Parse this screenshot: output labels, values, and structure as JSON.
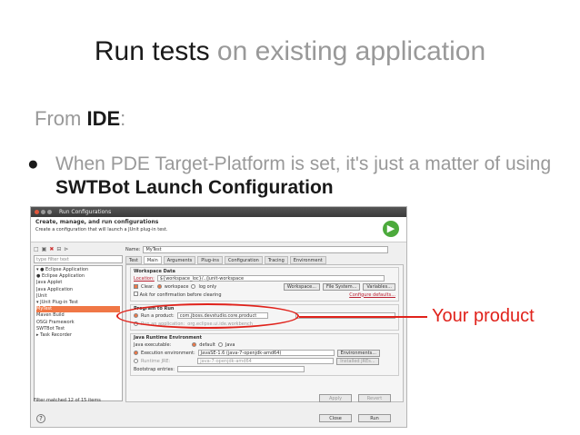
{
  "slide": {
    "title_dark": "Run tests",
    "title_light": " on existing application",
    "from_label": "From ",
    "from_ide": "IDE",
    "from_colon": ":",
    "bullet_dot": "●",
    "bullet_text_1": "When PDE Target-Platform is set, it's just a matter of using ",
    "bullet_bold": "SWTBot Launch Configuration",
    "callout": "Your product"
  },
  "dialog": {
    "window_title": "Run Configurations",
    "header_title": "Create, manage, and run configurations",
    "header_subtitle": "Create a configuration that will launch a JUnit plug-in test.",
    "run_icon": "play-icon",
    "filter_placeholder": "type filter text",
    "tree": [
      "▾ ● Eclipse Application",
      "   ● Eclipse Application",
      "  Java Applet",
      "  Java Application",
      "  JUnit",
      "▾ JUnit Plug-in Test",
      "   MyTest",
      "  Maven Build",
      "  OSGi Framework",
      "  SWTBot Test",
      "▸ Task Recorder"
    ],
    "filtered_status": "Filter matched 12 of 15 items",
    "name_label": "Name:",
    "name_value": "MyTest",
    "tabs": [
      "Test",
      "Main",
      "Arguments",
      "Plug-ins",
      "Configuration",
      "Tracing",
      "Environment"
    ],
    "workspace": {
      "group_label": "Workspace Data",
      "location_label": "Location:",
      "location_value": "${workspace_loc}/../junit-workspace",
      "workspace_btn": "Workspace...",
      "filesystem_btn": "File System...",
      "variables_btn": "Variables...",
      "clear_label": "Clear:",
      "clear_workspace": "workspace",
      "clear_log": "log only",
      "ask_label": "Ask for confirmation before clearing",
      "configure_link": "Configure defaults..."
    },
    "program": {
      "group_label": "Program to Run",
      "run_product_label": "Run a product:",
      "run_product_value": "com.jboss.devstudio.core.product",
      "run_application_label": "Run an application:",
      "run_application_value": "org.eclipse.ui.ide.workbench"
    },
    "java": {
      "group_label": "Java Runtime Environment",
      "executable_label": "Java executable:",
      "exec_default": "default",
      "exec_java": "Java",
      "env_label": "Execution environment:",
      "env_value": "JavaSE-1.6 (java-7-openjdk-amd64)",
      "environments_btn": "Environments...",
      "jre_label": "Runtime JRE:",
      "jre_value": "java-7-openjdk-amd64",
      "installed_btn": "Installed JREs...",
      "bootstrap_label": "Bootstrap entries:"
    },
    "apply_btn": "Apply",
    "revert_btn": "Revert",
    "close_btn": "Close",
    "run_btn": "Run",
    "help_icon": "help-icon"
  }
}
